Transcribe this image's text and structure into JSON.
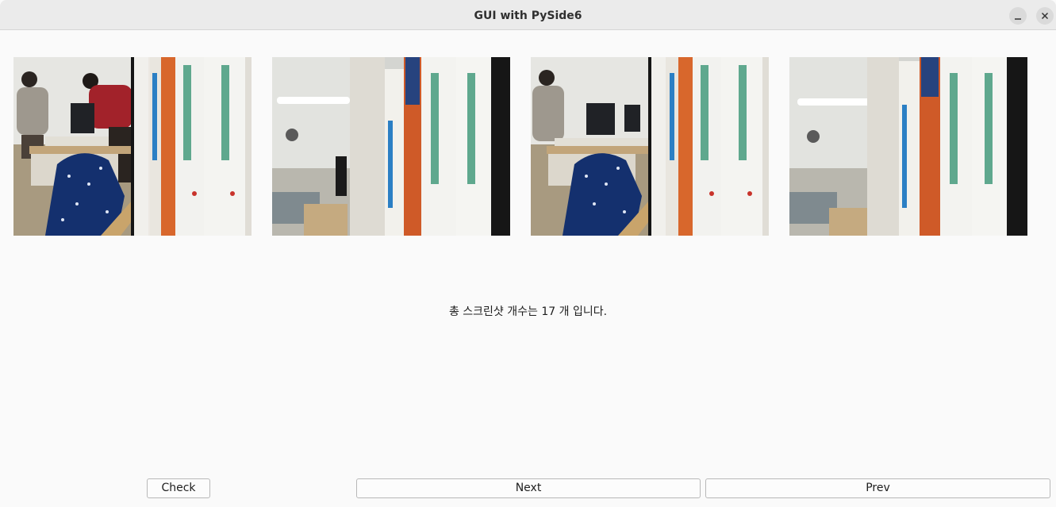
{
  "window": {
    "title": "GUI with PySide6",
    "controls": [
      "minimize-icon",
      "close-icon"
    ]
  },
  "thumbnails": [
    {
      "scene": "office with people, chair with blue blanket, books"
    },
    {
      "scene": "books close-up, ceiling light, lab"
    },
    {
      "scene": "office with person, chair with blue blanket, books"
    },
    {
      "scene": "books close-up, ceiling light, lab"
    }
  ],
  "status_text": "총 스크린샷 개수는 17 개 입니다.",
  "buttons": {
    "check": "Check",
    "next": "Next",
    "prev": "Prev"
  }
}
